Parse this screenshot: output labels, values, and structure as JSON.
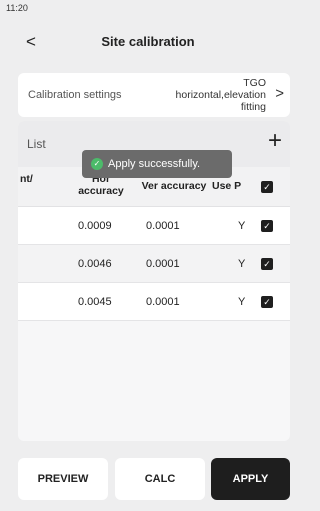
{
  "status_bar": {
    "time": "11:20"
  },
  "header": {
    "back_icon": "chevron-left-icon",
    "title": "Site calibration"
  },
  "calibration_settings": {
    "label": "Calibration settings",
    "value": "TGO horizontal,elevation fitting",
    "chevron_icon": "chevron-right-icon"
  },
  "list": {
    "title": "List",
    "add_icon": "plus-icon",
    "columns": {
      "point": "nt/",
      "hor_accuracy": "Hor accuracy",
      "ver_accuracy": "Ver accuracy",
      "use": "Use P"
    },
    "rows": [
      {
        "hor": "0.0009",
        "ver": "0.0001",
        "use": "Y",
        "checked": true
      },
      {
        "hor": "0.0046",
        "ver": "0.0001",
        "use": "Y",
        "checked": true
      },
      {
        "hor": "0.0045",
        "ver": "0.0001",
        "use": "Y",
        "checked": true
      }
    ]
  },
  "toast": {
    "icon": "check-circle-icon",
    "message": "Apply successfully."
  },
  "buttons": {
    "preview": "PREVIEW",
    "calc": "CALC",
    "apply": "APPLY"
  },
  "colors": {
    "primary_dark": "#1e1e1e",
    "success": "#4cbb6a",
    "background": "#eeeeef"
  }
}
